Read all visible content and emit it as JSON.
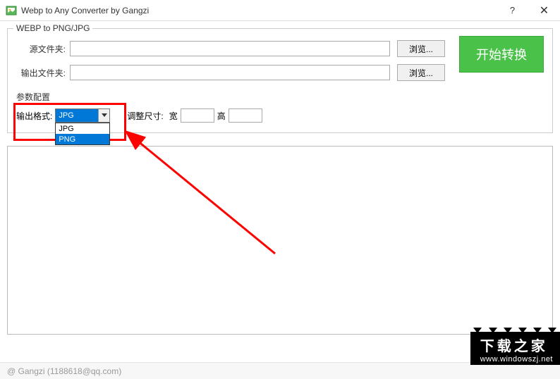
{
  "window": {
    "title": "Webp to Any Converter by Gangzi",
    "help_symbol": "?",
    "close_symbol": "✕"
  },
  "groupbox": {
    "legend": "WEBP to PNG/JPG",
    "source_label": "源文件夹:",
    "output_label": "输出文件夹:",
    "browse_label": "浏览...",
    "start_label": "开始转换",
    "params_label": "参数配置",
    "format_label": "输出格式:",
    "format_value": "JPG",
    "format_options": [
      "JPG",
      "PNG"
    ],
    "resize_label": "调整尺寸:",
    "width_label": "宽",
    "height_label": "高"
  },
  "footer": {
    "credit": "@ Gangzi (1188618@qq.com)"
  },
  "watermark": {
    "line1": "下载之家",
    "line2": "www.windowszj.net"
  }
}
